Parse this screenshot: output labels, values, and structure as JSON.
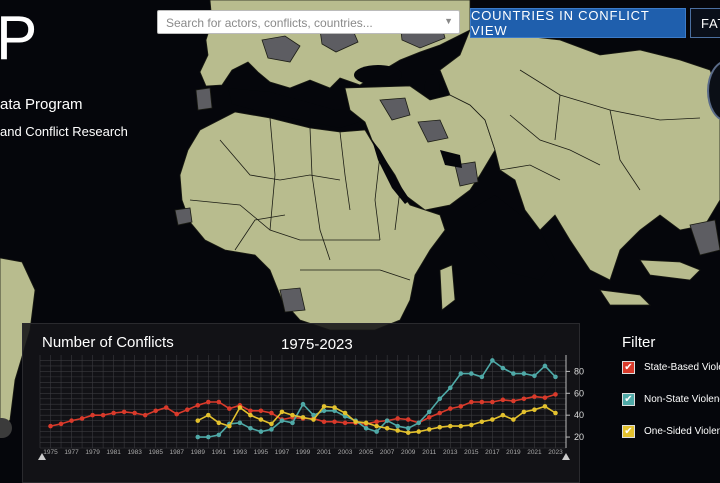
{
  "header": {
    "logo_text": "P",
    "subtitle_line1": "ata Program",
    "subtitle_line2": "and Conflict Research"
  },
  "search": {
    "placeholder": "Search for actors, conflicts, countries...",
    "value": ""
  },
  "buttons": {
    "countries_view": "COUNTRIES IN CONFLICT VIEW",
    "fatalities": "FAT"
  },
  "chart_panel": {
    "title": "Number of Conflicts",
    "range": "1975-2023"
  },
  "filter": {
    "title": "Filter",
    "items": [
      {
        "label": "State-Based Violence",
        "color": "#d93a2b",
        "checked": true
      },
      {
        "label": "Non-State Violence",
        "color": "#4fa9a7",
        "checked": true
      },
      {
        "label": "One-Sided Violence",
        "color": "#e3c12e",
        "checked": true
      }
    ]
  },
  "chart_data": {
    "type": "line",
    "x_ticks": [
      "1975",
      "1977",
      "1979",
      "1981",
      "1983",
      "1985",
      "1987",
      "1989",
      "1991",
      "1993",
      "1995",
      "1997",
      "1999",
      "2001",
      "2003",
      "2005",
      "2007",
      "2009",
      "2011",
      "2013",
      "2015",
      "2017",
      "2019",
      "2021",
      "2023"
    ],
    "y_ticks": [
      "20",
      "40",
      "60",
      "80"
    ],
    "ylim": [
      10,
      95
    ],
    "xlim": [
      1974,
      2024
    ],
    "series": [
      {
        "name": "State-Based Violence",
        "color": "#d93a2b",
        "x": [
          1975,
          1976,
          1977,
          1978,
          1979,
          1980,
          1981,
          1982,
          1983,
          1984,
          1985,
          1986,
          1987,
          1988,
          1989,
          1990,
          1991,
          1992,
          1993,
          1994,
          1995,
          1996,
          1997,
          1998,
          1999,
          2000,
          2001,
          2002,
          2003,
          2004,
          2005,
          2006,
          2007,
          2008,
          2009,
          2010,
          2011,
          2012,
          2013,
          2014,
          2015,
          2016,
          2017,
          2018,
          2019,
          2020,
          2021,
          2022,
          2023
        ],
        "y": [
          30,
          32,
          35,
          37,
          40,
          40,
          42,
          43,
          42,
          40,
          44,
          47,
          41,
          45,
          49,
          52,
          52,
          46,
          49,
          44,
          44,
          42,
          36,
          38,
          37,
          37,
          34,
          34,
          33,
          33,
          32,
          34,
          35,
          37,
          36,
          33,
          38,
          42,
          46,
          48,
          52,
          52,
          52,
          54,
          53,
          55,
          57,
          56,
          59
        ]
      },
      {
        "name": "Non-State Violence",
        "color": "#4fa9a7",
        "x": [
          1989,
          1990,
          1991,
          1992,
          1993,
          1994,
          1995,
          1996,
          1997,
          1998,
          1999,
          2000,
          2001,
          2002,
          2003,
          2004,
          2005,
          2006,
          2007,
          2008,
          2009,
          2010,
          2011,
          2012,
          2013,
          2014,
          2015,
          2016,
          2017,
          2018,
          2019,
          2020,
          2021,
          2022,
          2023
        ],
        "y": [
          20,
          20,
          22,
          32,
          33,
          28,
          25,
          27,
          35,
          33,
          50,
          40,
          44,
          44,
          39,
          35,
          28,
          25,
          35,
          30,
          28,
          33,
          43,
          55,
          65,
          78,
          78,
          75,
          90,
          83,
          78,
          78,
          76,
          85,
          75
        ]
      },
      {
        "name": "One-Sided Violence",
        "color": "#e3c12e",
        "x": [
          1989,
          1990,
          1991,
          1992,
          1993,
          1994,
          1995,
          1996,
          1997,
          1998,
          1999,
          2000,
          2001,
          2002,
          2003,
          2004,
          2005,
          2006,
          2007,
          2008,
          2009,
          2010,
          2011,
          2012,
          2013,
          2014,
          2015,
          2016,
          2017,
          2018,
          2019,
          2020,
          2021,
          2022,
          2023
        ],
        "y": [
          35,
          40,
          33,
          30,
          47,
          40,
          36,
          32,
          43,
          40,
          38,
          36,
          48,
          47,
          42,
          34,
          33,
          30,
          28,
          26,
          24,
          25,
          27,
          29,
          30,
          30,
          31,
          34,
          36,
          40,
          36,
          43,
          45,
          48,
          42
        ]
      }
    ]
  }
}
